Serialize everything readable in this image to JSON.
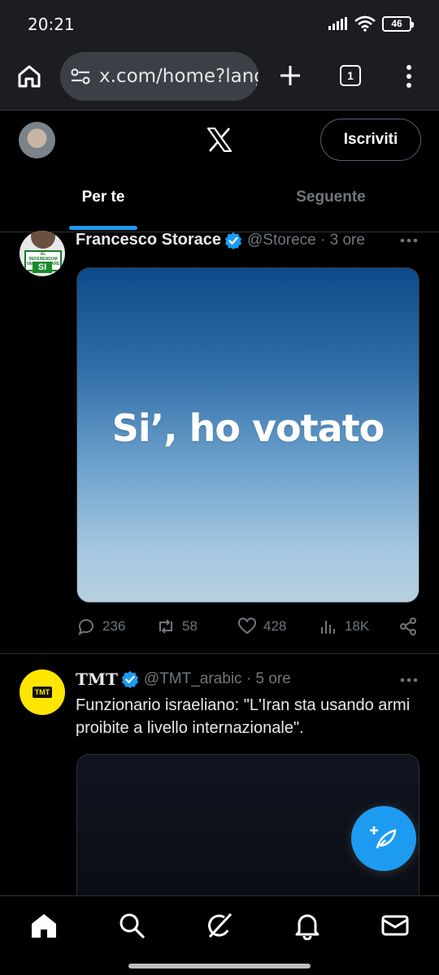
{
  "status_bar": {
    "time": "20:21",
    "battery": "46"
  },
  "browser": {
    "url": "x.com/home?lang",
    "tab_count": "1"
  },
  "header": {
    "signup_label": "Iscriviti"
  },
  "tabs": [
    {
      "label": "Per te",
      "active": true
    },
    {
      "label": "Seguente",
      "active": false
    }
  ],
  "tweets": [
    {
      "name": "Francesco Storace",
      "handle": "@Storece · 3 ore",
      "image_text": "Si’, ho votato",
      "avatar_banner": "AL REFERENDUM VADO A VOTARE",
      "avatar_badge": "SI",
      "stats": {
        "replies": "236",
        "reposts": "58",
        "likes": "428",
        "views": "18K"
      }
    },
    {
      "name": "TMT",
      "handle": "@TMT_arabic · 5 ore",
      "avatar_label": "TMT",
      "text": "Funzionario israeliano: \"L'Iran sta usando armi proibite a livello internazionale\"."
    }
  ],
  "colors": {
    "accent": "#1d9bf0",
    "background": "#000000",
    "muted": "#71767b"
  }
}
